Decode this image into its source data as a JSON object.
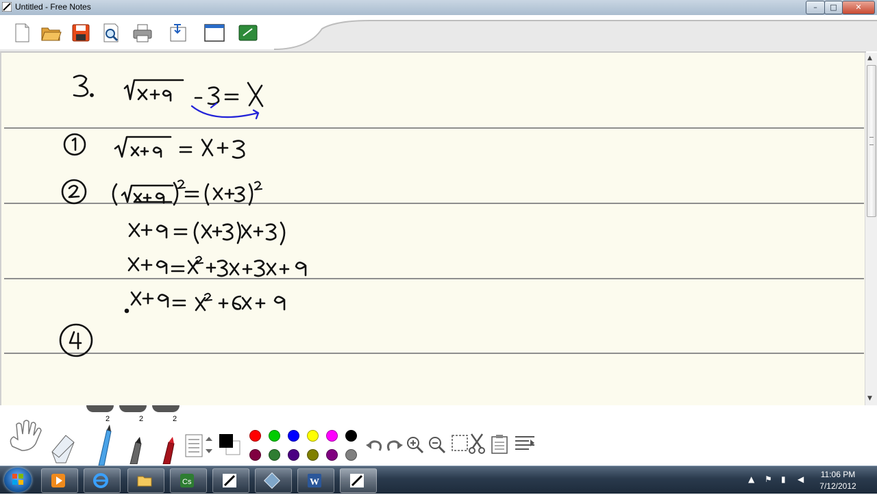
{
  "window": {
    "title": "Untitled - Free Notes",
    "controls": {
      "minimize": "–",
      "maximize": "□",
      "close": "✕"
    }
  },
  "toolbar": {
    "icons": [
      "new-page-icon",
      "open-folder-icon",
      "save-icon",
      "print-preview-icon",
      "print-icon",
      "export-icon",
      "window-icon",
      "green-board-icon"
    ]
  },
  "notes": {
    "lines": [
      "3.  √(x+9) - 3 = x",
      "①  √(x+9) = x+3",
      "②  (√(x+9))² = (x+3)²",
      "x+9 = (x+3)(x+3)",
      "x+9 = x²+3x+3x+9",
      "x+9 = x²+6x+9",
      "④"
    ]
  },
  "tray": {
    "pen_sizes": [
      "2",
      "2",
      "2"
    ],
    "colors_top": [
      "#000000",
      "#ff0000",
      "#00cc00",
      "#0000ff",
      "#ffff00",
      "#ff00ff",
      "#000000"
    ],
    "colors_bottom": [
      "#800040",
      "#2e7d32",
      "#4b0082",
      "#808000",
      "#800080",
      "#808080"
    ],
    "tools": [
      "hand-icon",
      "eraser-icon",
      "pencil-icon",
      "marker-icon",
      "red-marker-icon",
      "text-lines-icon",
      "color-picker-icon",
      "undo-icon",
      "redo-icon",
      "zoom-in-icon",
      "zoom-out-icon",
      "select-icon",
      "cut-icon",
      "paste-icon",
      "align-icon"
    ]
  },
  "taskbar": {
    "apps": [
      "media-player-icon",
      "internet-explorer-icon",
      "file-explorer-icon",
      "camtasia-icon",
      "free-notes-icon",
      "network-tool-icon",
      "word-icon",
      "free-notes-active-icon"
    ],
    "time": "11:06 PM",
    "date": "7/12/2012"
  }
}
